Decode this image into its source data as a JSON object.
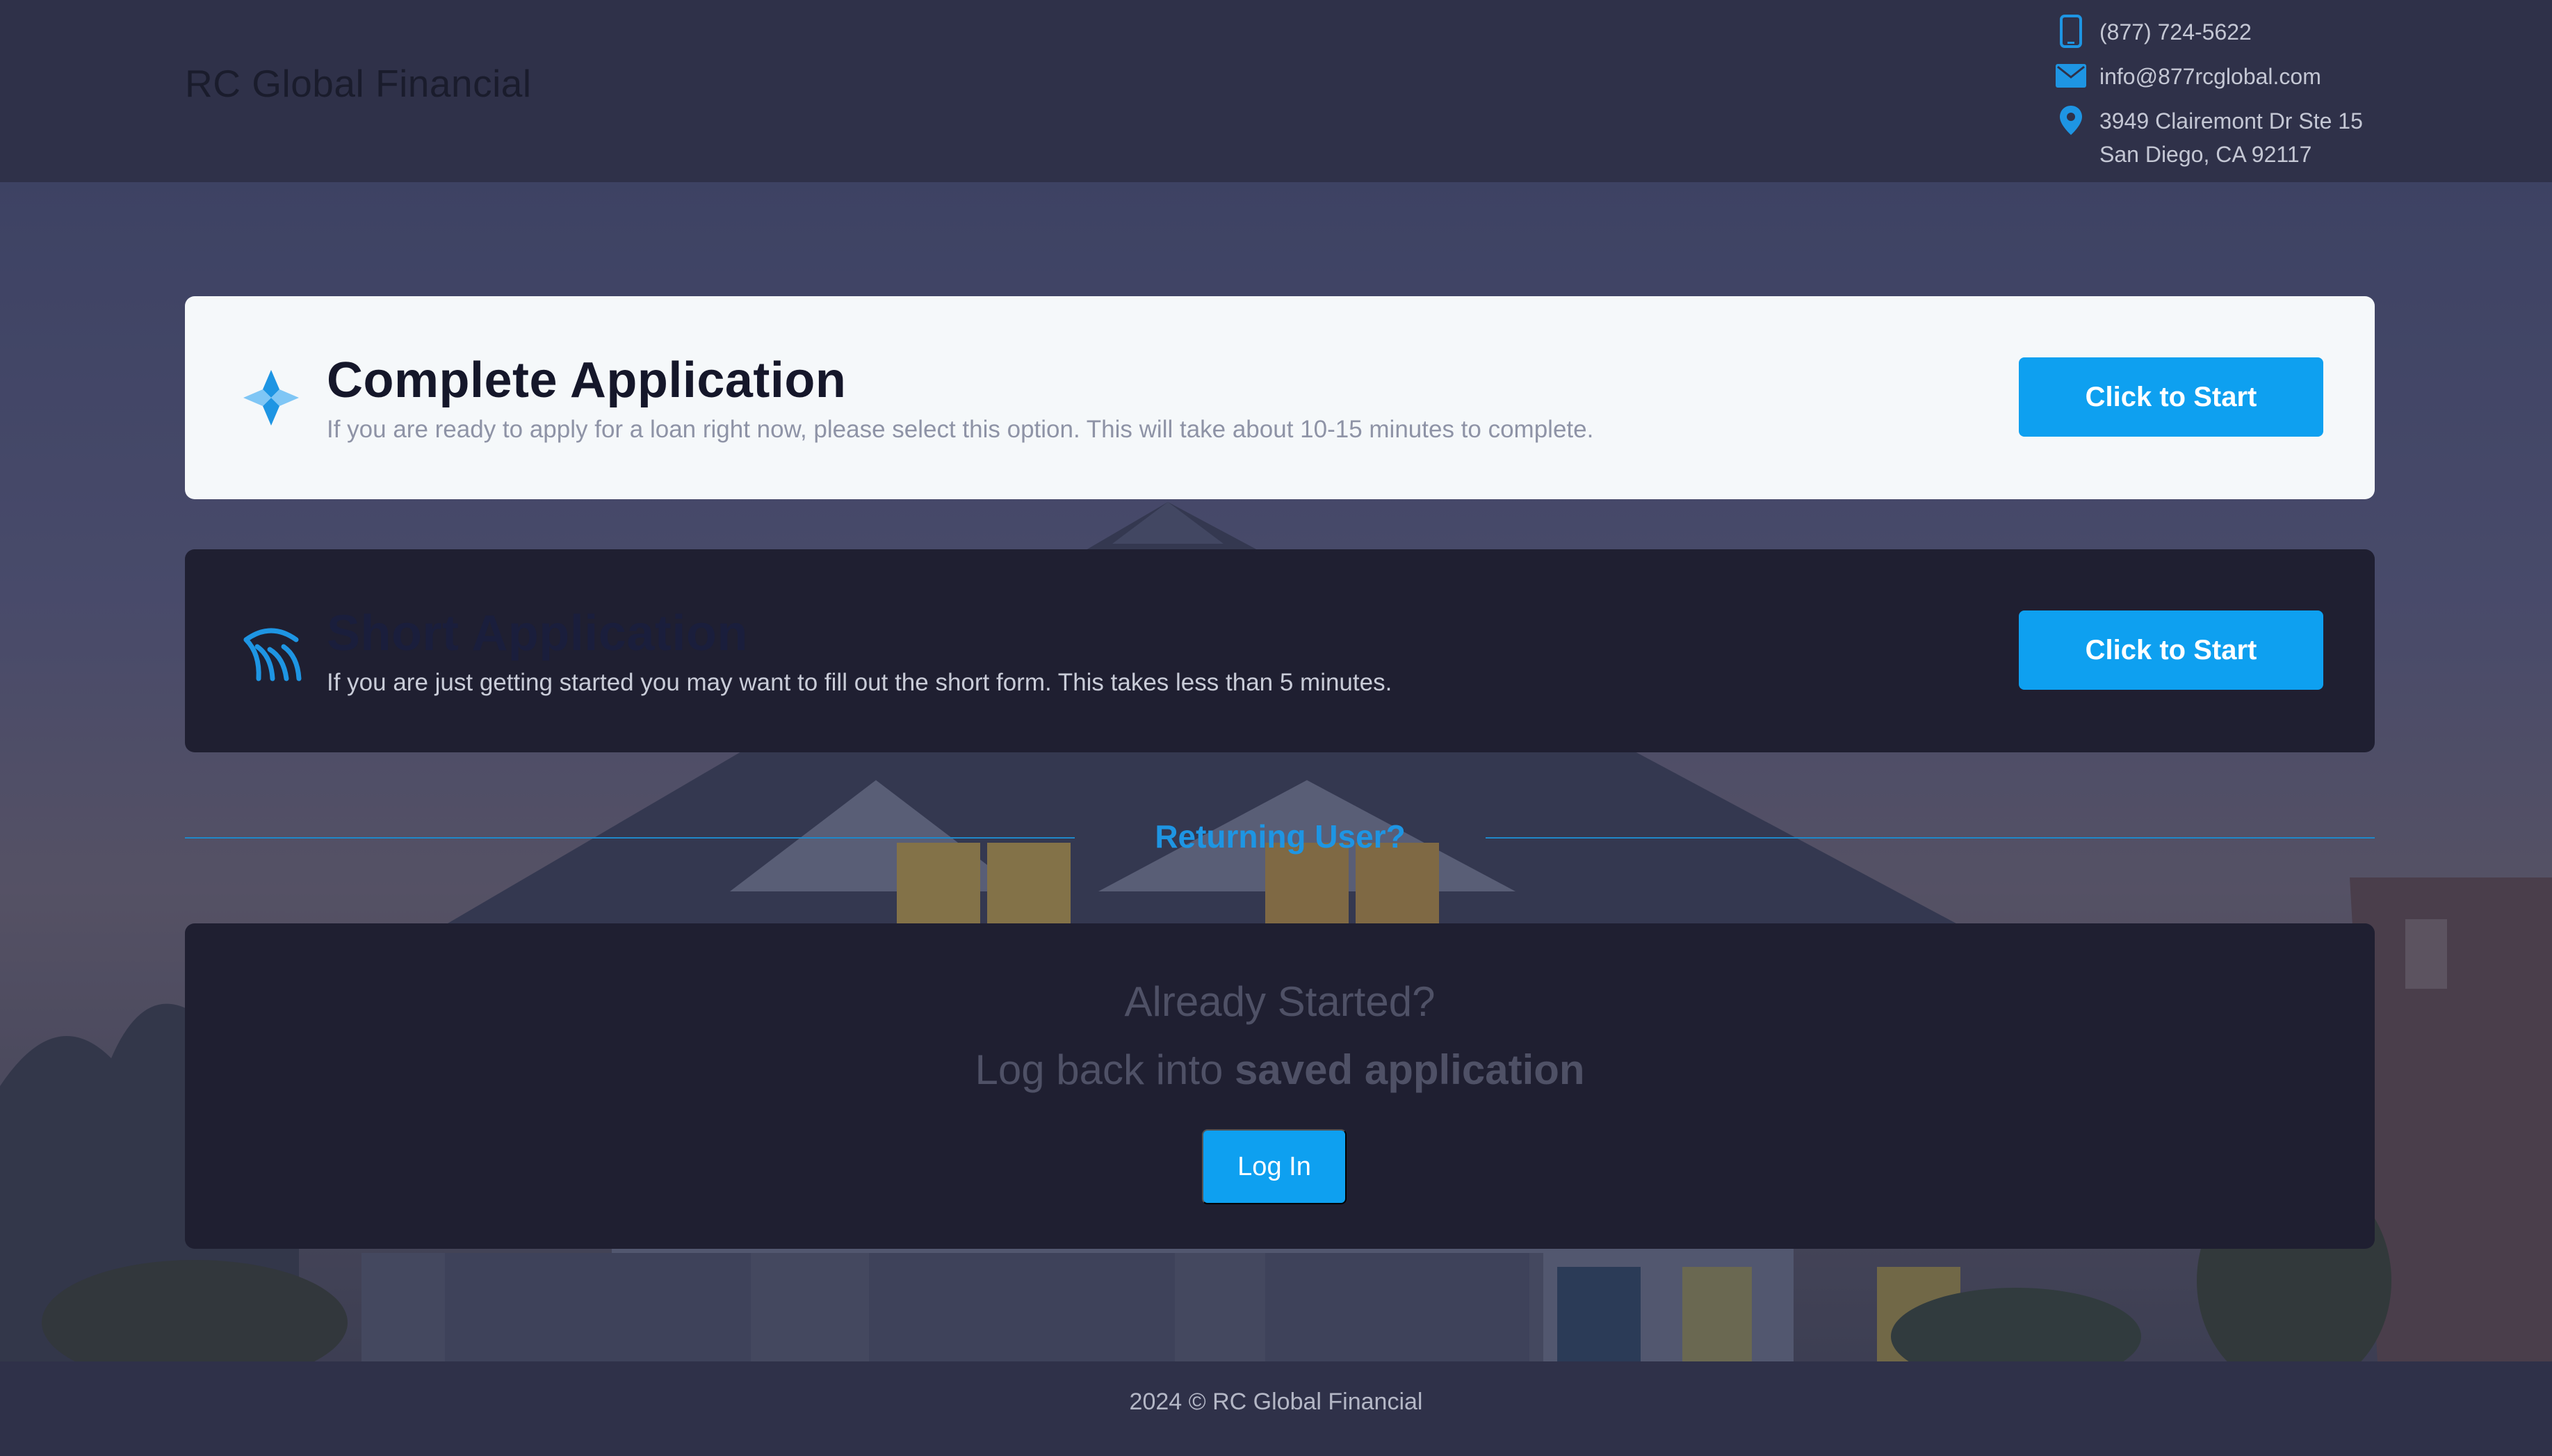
{
  "header": {
    "brand": "RC Global Financial",
    "phone": "(877) 724-5622",
    "email": "info@877rcglobal.com",
    "address_line1": "3949 Clairemont Dr Ste 15",
    "address_line2": "San Diego, CA 92117",
    "icons": [
      "phone-icon",
      "mail-icon",
      "location-pin-icon"
    ]
  },
  "complete_application": {
    "title": "Complete Application",
    "description": "If you are ready to apply for a loan right now, please select this option. This will take about 10-15 minutes to complete.",
    "button_label": "Click to Start",
    "icon": "pinwheel-icon"
  },
  "short_application": {
    "title": "Short Application",
    "description": "If you are just getting started you may want to fill out the short form. This takes less than 5 minutes.",
    "button_label": "Click to Start",
    "icon": "wheat-arcs-icon"
  },
  "returning": {
    "heading": "Returning User?",
    "line1": "Already Started?",
    "line2_prefix": "Log back into ",
    "line2_bold": "saved application",
    "button_label": "Log In"
  },
  "footer": {
    "text": "2024 © RC Global Financial"
  },
  "colors": {
    "accent": "#0ea0f0",
    "header_bg": "#2f3149",
    "card_dark": "#1f1f31",
    "card_light": "#f5f8fa"
  }
}
